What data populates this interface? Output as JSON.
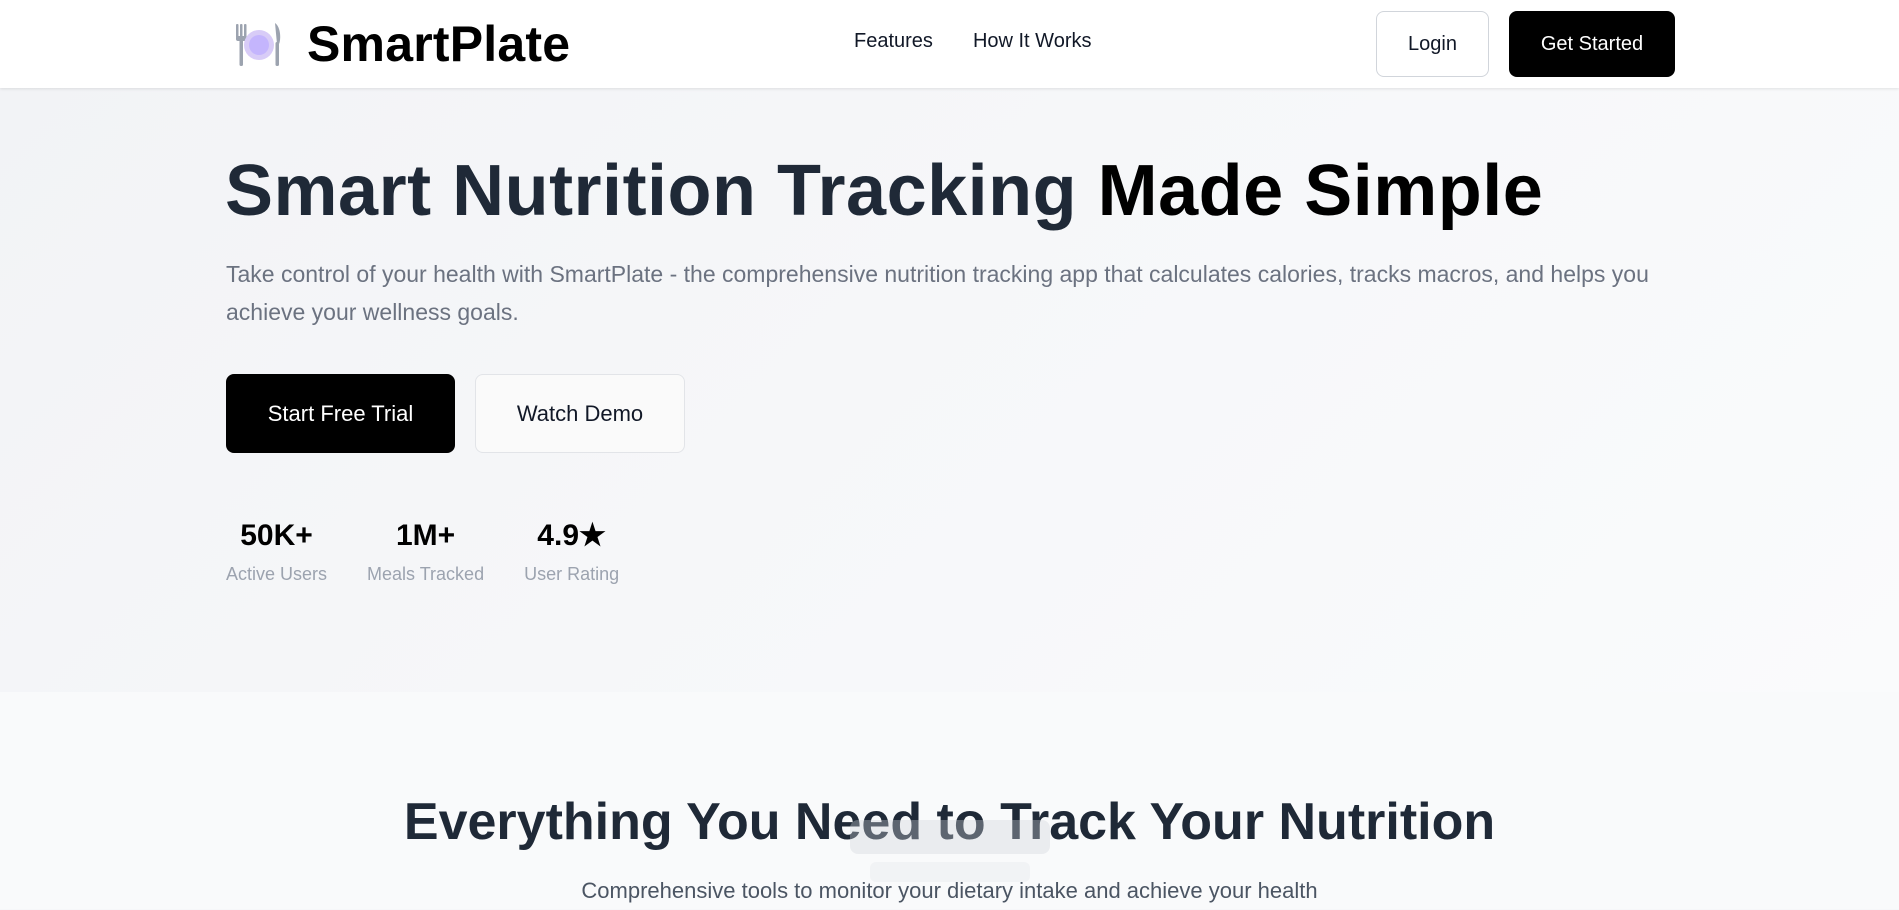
{
  "header": {
    "brand_name": "SmartPlate",
    "brand_icon": "plate-cutlery-icon",
    "nav": [
      {
        "label": "Features"
      },
      {
        "label": "How It Works"
      }
    ],
    "login_label": "Login",
    "get_started_label": "Get Started"
  },
  "hero": {
    "title_part1": "Smart Nutrition Tracking",
    "title_part2": "Made Simple",
    "subtitle": "Take control of your health with SmartPlate - the comprehensive nutrition tracking app that calculates calories, tracks macros, and helps you achieve your wellness goals.",
    "primary_cta": "Start Free Trial",
    "secondary_cta": "Watch Demo",
    "stats": [
      {
        "value": "50K+",
        "label": "Active Users"
      },
      {
        "value": "1M+",
        "label": "Meals Tracked"
      },
      {
        "value": "4.9★",
        "label": "User Rating"
      }
    ]
  },
  "features": {
    "title": "Everything You Need to Track Your Nutrition",
    "subtitle": "Comprehensive tools to monitor your dietary intake and achieve your health"
  },
  "colors": {
    "primary": "#000000",
    "text_dark": "#1f2937",
    "text_muted": "#6b7280",
    "background": "#f6f7f9",
    "icon_plate": "#c4b5fd"
  }
}
